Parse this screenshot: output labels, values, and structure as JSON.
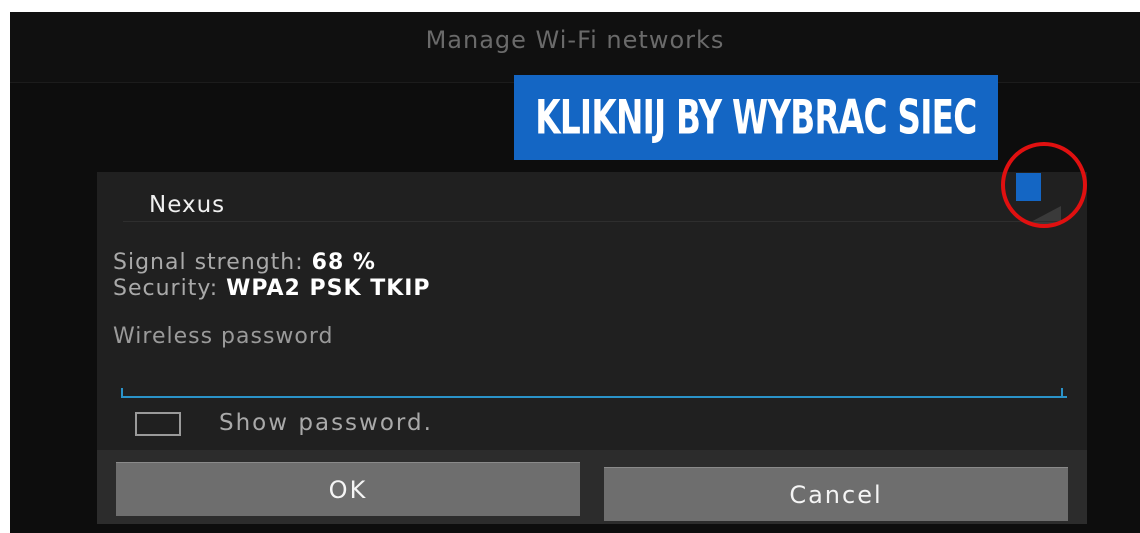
{
  "topbar": {
    "title": "Manage Wi-Fi networks"
  },
  "banner": {
    "text": "KLIKNIJ BY WYBRAC SIEC"
  },
  "dialog": {
    "network_name": "Nexus",
    "signal_label": "Signal strength:",
    "signal_value": "68 %",
    "security_label": "Security:",
    "security_value": "WPA2 PSK TKIP",
    "password_label": "Wireless password",
    "password_value": "",
    "show_password_label": "Show password.",
    "show_password_checked": false,
    "ok_label": "OK",
    "cancel_label": "Cancel"
  },
  "colors": {
    "accent_blue": "#1466c4",
    "input_underline": "#2a93c9",
    "highlight_circle": "#e01010"
  }
}
